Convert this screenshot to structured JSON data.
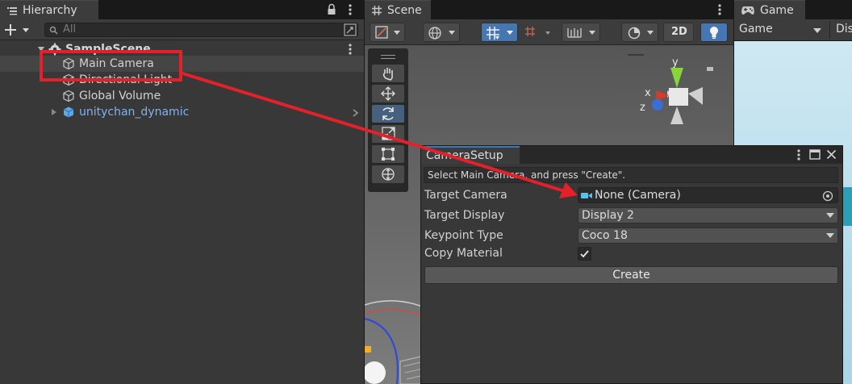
{
  "hierarchy": {
    "tab_label": "Hierarchy",
    "search_placeholder": "All",
    "rows": [
      {
        "label": "SampleScene"
      },
      {
        "label": "Main Camera"
      },
      {
        "label": "Directional Light"
      },
      {
        "label": "Global Volume"
      },
      {
        "label": "unitychan_dynamic"
      }
    ]
  },
  "scene": {
    "tab_label": "Scene",
    "toolbar_2d_label": "2D",
    "gizmo_axes": {
      "x": "x",
      "y": "y",
      "z": "z"
    }
  },
  "game": {
    "tab_label": "Game",
    "display_label": "Game",
    "display_select": "Dis"
  },
  "camera_setup": {
    "tab_label": "CameraSetup",
    "help_text": "Select Main Camera, and press \"Create\".",
    "fields": {
      "target_camera": {
        "label": "Target Camera",
        "value": "None (Camera)"
      },
      "target_display": {
        "label": "Target Display",
        "value": "Display 2"
      },
      "keypoint_type": {
        "label": "Keypoint Type",
        "value": "Coco 18"
      },
      "copy_material": {
        "label": "Copy Material",
        "checked": true
      }
    },
    "create_label": "Create"
  },
  "colors": {
    "highlight_red": "#e4202a",
    "accent_blue": "#3a79bb",
    "prefab_blue": "#7fb2f0"
  }
}
